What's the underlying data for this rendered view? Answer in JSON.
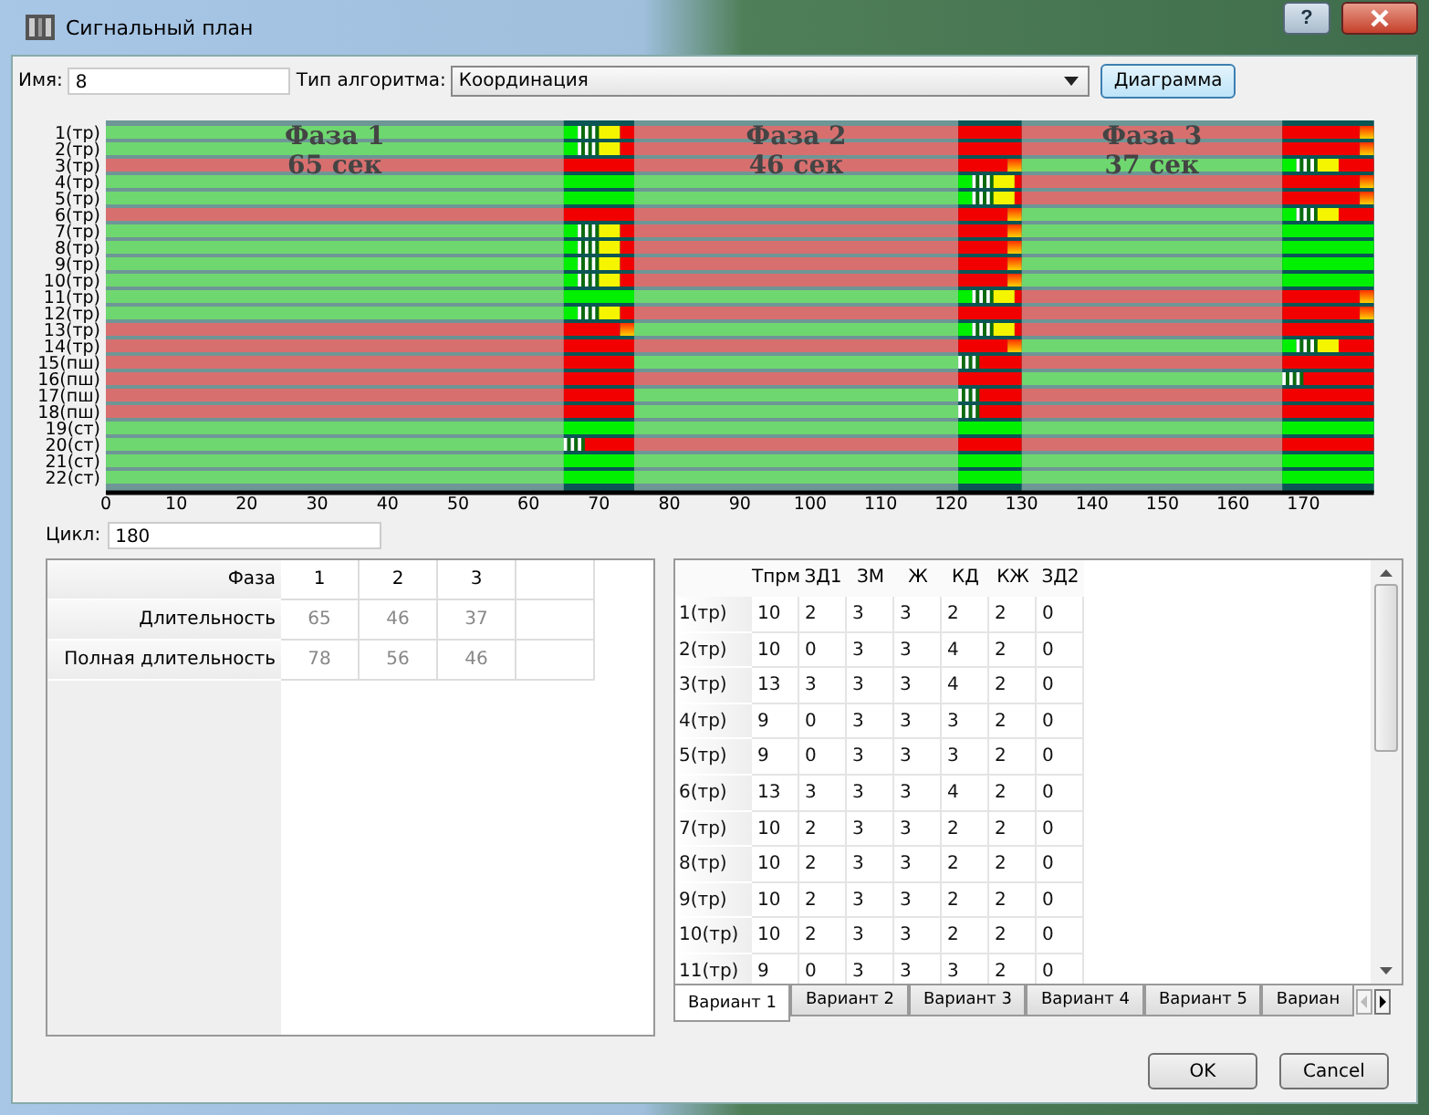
{
  "window": {
    "title": "Сигнальный план",
    "help": "?"
  },
  "form": {
    "name_label": "Имя:",
    "name_value": "8",
    "algorithm_label": "Тип алгоритма:",
    "algorithm_value": "Координация",
    "diagram_button": "Диаграмма"
  },
  "diagram": {
    "phase_labels": [
      {
        "title": "Фаза 1",
        "duration": "65 сек"
      },
      {
        "title": "Фаза 2",
        "duration": "46 сек"
      },
      {
        "title": "Фаза 3",
        "duration": "37 сек"
      }
    ],
    "rows": [
      {
        "label": "1(тр)",
        "kind": "vehicle",
        "open": [
          true,
          false,
          false
        ]
      },
      {
        "label": "2(тр)",
        "kind": "vehicle",
        "open": [
          true,
          false,
          false
        ]
      },
      {
        "label": "3(тр)",
        "kind": "vehicle",
        "open": [
          false,
          false,
          true
        ]
      },
      {
        "label": "4(тр)",
        "kind": "vehicle",
        "open": [
          true,
          true,
          false
        ]
      },
      {
        "label": "5(тр)",
        "kind": "vehicle",
        "open": [
          true,
          true,
          false
        ]
      },
      {
        "label": "6(тр)",
        "kind": "vehicle",
        "open": [
          false,
          false,
          true
        ]
      },
      {
        "label": "7(тр)",
        "kind": "vehicle",
        "open": [
          true,
          false,
          true
        ]
      },
      {
        "label": "8(тр)",
        "kind": "vehicle",
        "open": [
          true,
          false,
          true
        ]
      },
      {
        "label": "9(тр)",
        "kind": "vehicle",
        "open": [
          true,
          false,
          true
        ]
      },
      {
        "label": "10(тр)",
        "kind": "vehicle",
        "open": [
          true,
          false,
          true
        ]
      },
      {
        "label": "11(тр)",
        "kind": "vehicle",
        "open": [
          true,
          true,
          false
        ]
      },
      {
        "label": "12(тр)",
        "kind": "vehicle",
        "open": [
          true,
          false,
          false
        ]
      },
      {
        "label": "13(тр)",
        "kind": "vehicle",
        "open": [
          false,
          true,
          false
        ]
      },
      {
        "label": "14(тр)",
        "kind": "vehicle",
        "open": [
          false,
          false,
          true
        ]
      },
      {
        "label": "15(пш)",
        "kind": "pedestrian",
        "open": [
          false,
          true,
          false
        ]
      },
      {
        "label": "16(пш)",
        "kind": "pedestrian",
        "open": [
          false,
          false,
          true
        ]
      },
      {
        "label": "17(пш)",
        "kind": "pedestrian",
        "open": [
          false,
          true,
          false
        ]
      },
      {
        "label": "18(пш)",
        "kind": "pedestrian",
        "open": [
          false,
          true,
          false
        ]
      },
      {
        "label": "19(ст)",
        "kind": "tram",
        "open": [
          true,
          true,
          true
        ]
      },
      {
        "label": "20(ст)",
        "kind": "tram",
        "open": [
          true,
          false,
          false
        ]
      },
      {
        "label": "21(ст)",
        "kind": "tram",
        "open": [
          true,
          true,
          true
        ]
      },
      {
        "label": "22(ст)",
        "kind": "tram",
        "open": [
          true,
          true,
          true
        ]
      }
    ],
    "x_ticks": [
      "0",
      "10",
      "20",
      "30",
      "40",
      "50",
      "60",
      "70",
      "80",
      "90",
      "100",
      "110",
      "120",
      "130",
      "140",
      "150",
      "160",
      "170"
    ]
  },
  "cycle": {
    "label": "Цикл:",
    "value": "180"
  },
  "phase_table": {
    "row_headers": [
      "Фаза",
      "Длительность",
      "Полная длительность"
    ],
    "rows": [
      [
        "1",
        "2",
        "3"
      ],
      [
        "65",
        "46",
        "37"
      ],
      [
        "78",
        "56",
        "46"
      ]
    ]
  },
  "variant_table": {
    "columns": [
      "Тпрм",
      "ЗД1",
      "ЗМ",
      "Ж",
      "КД",
      "КЖ",
      "ЗД2"
    ],
    "rows": [
      {
        "header": "1(тр)",
        "cells": [
          "10",
          "2",
          "3",
          "3",
          "2",
          "2",
          "0"
        ]
      },
      {
        "header": "2(тр)",
        "cells": [
          "10",
          "0",
          "3",
          "3",
          "4",
          "2",
          "0"
        ]
      },
      {
        "header": "3(тр)",
        "cells": [
          "13",
          "3",
          "3",
          "3",
          "4",
          "2",
          "0"
        ]
      },
      {
        "header": "4(тр)",
        "cells": [
          "9",
          "0",
          "3",
          "3",
          "3",
          "2",
          "0"
        ]
      },
      {
        "header": "5(тр)",
        "cells": [
          "9",
          "0",
          "3",
          "3",
          "3",
          "2",
          "0"
        ]
      },
      {
        "header": "6(тр)",
        "cells": [
          "13",
          "3",
          "3",
          "3",
          "4",
          "2",
          "0"
        ]
      },
      {
        "header": "7(тр)",
        "cells": [
          "10",
          "2",
          "3",
          "3",
          "2",
          "2",
          "0"
        ]
      },
      {
        "header": "8(тр)",
        "cells": [
          "10",
          "2",
          "3",
          "3",
          "2",
          "2",
          "0"
        ]
      },
      {
        "header": "9(тр)",
        "cells": [
          "10",
          "2",
          "3",
          "3",
          "2",
          "2",
          "0"
        ]
      },
      {
        "header": "10(тр)",
        "cells": [
          "10",
          "2",
          "3",
          "3",
          "2",
          "2",
          "0"
        ]
      },
      {
        "header": "11(тр)",
        "cells": [
          "9",
          "0",
          "3",
          "3",
          "3",
          "2",
          "0"
        ]
      }
    ]
  },
  "tabs": [
    {
      "label": "Вариант 1",
      "selected": true
    },
    {
      "label": "Вариант 2",
      "selected": false
    },
    {
      "label": "Вариант 3",
      "selected": false
    },
    {
      "label": "Вариант 4",
      "selected": false
    },
    {
      "label": "Вариант 5",
      "selected": false
    },
    {
      "label": "Вариан",
      "selected": false
    }
  ],
  "buttons": [
    "OK",
    "Cancel"
  ]
}
